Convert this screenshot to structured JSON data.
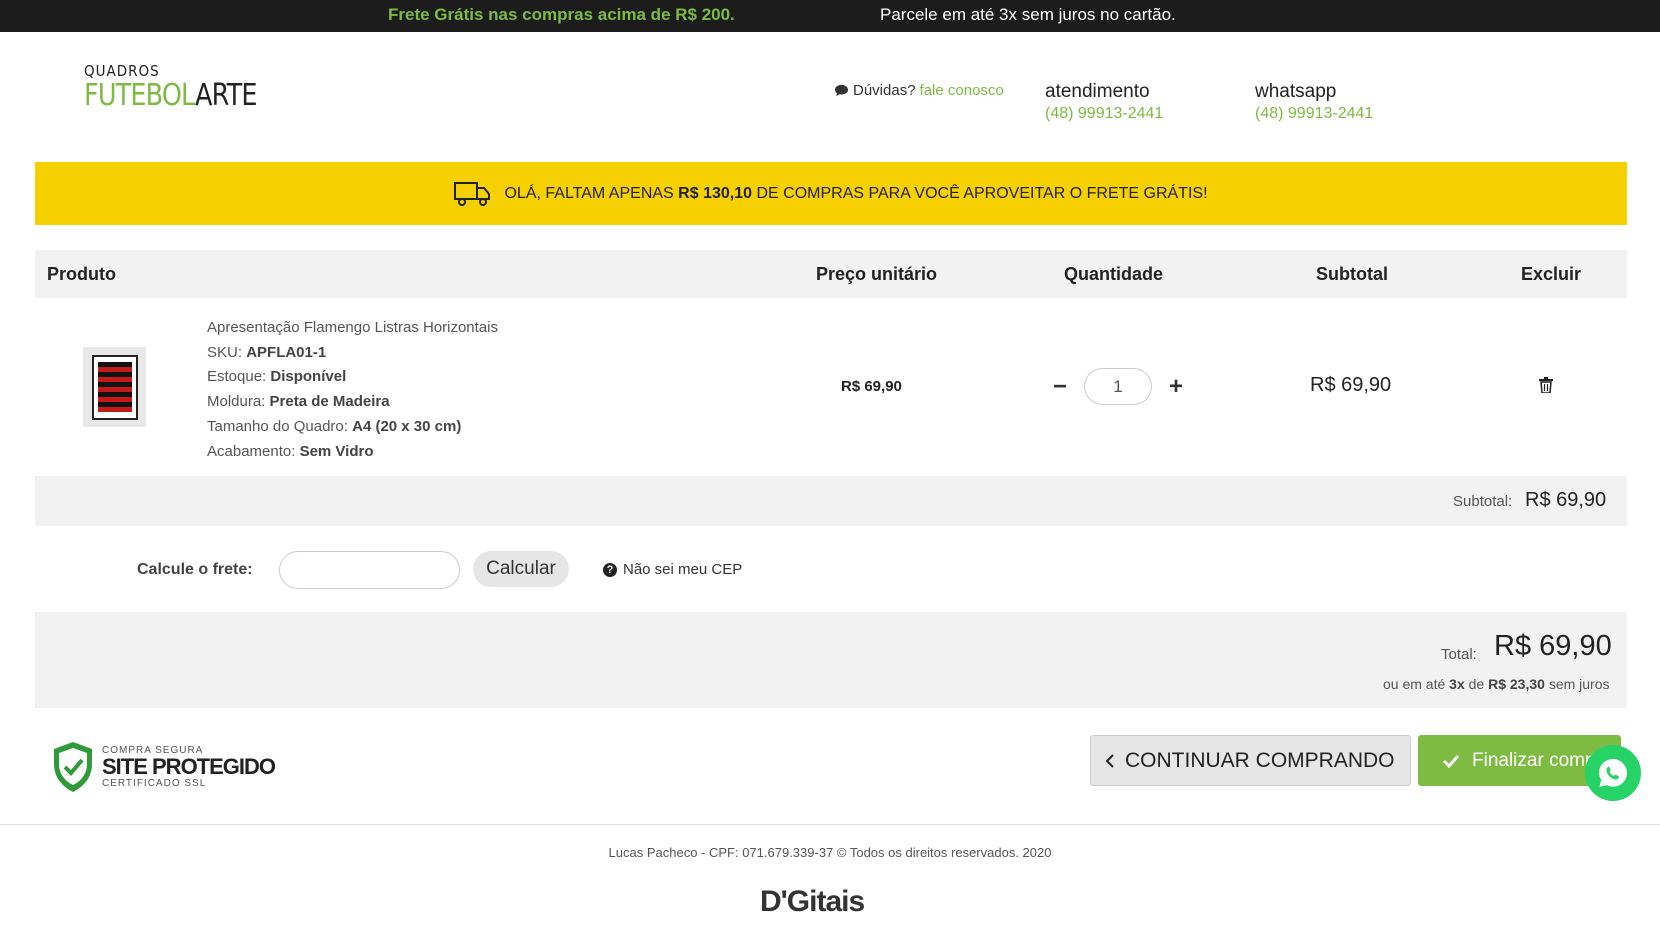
{
  "topbar": {
    "promo_free_shipping": "Frete Grátis nas compras acima de R$ 200.",
    "promo_installments": "Parcele em até 3x sem juros no cartão."
  },
  "header": {
    "logo_top": "QUADROS",
    "logo_bottom_green": "FUTEBOL",
    "logo_bottom_dark": "ARTE",
    "questions_label": "Dúvidas?",
    "contact_link": "fale conosco",
    "service_label": "atendimento",
    "service_phone": "(48) 99913-2441",
    "whatsapp_label": "whatsapp",
    "whatsapp_phone": "(48) 99913-2441"
  },
  "shipping_banner": {
    "prefix": "OLÁ, FALTAM APENAS",
    "amount": "R$ 130,10",
    "suffix": "DE COMPRAS PARA VOCÊ APROVEITAR O FRETE GRÁTIS!"
  },
  "table": {
    "headers": {
      "product": "Produto",
      "unit_price": "Preço unitário",
      "quantity": "Quantidade",
      "subtotal": "Subtotal",
      "delete": "Excluir"
    }
  },
  "cart_item": {
    "name": "Apresentação Flamengo Listras Horizontais",
    "sku_label": "SKU:",
    "sku": "APFLA01-1",
    "stock_label": "Estoque:",
    "stock": "Disponível",
    "frame_label": "Moldura:",
    "frame": "Preta de Madeira",
    "size_label": "Tamanho do Quadro:",
    "size": "A4 (20 x 30 cm)",
    "finish_label": "Acabamento:",
    "finish": "Sem Vidro",
    "unit_price": "R$ 69,90",
    "quantity": "1",
    "subtotal": "R$ 69,90",
    "minus": "−",
    "plus": "+"
  },
  "summary": {
    "subtotal_label": "Subtotal:",
    "subtotal_value": "R$ 69,90",
    "total_label": "Total:",
    "total_value": "R$ 69,90",
    "installments_prefix": "ou em até",
    "installments_count": "3x",
    "installments_of": "de",
    "installments_value": "R$ 23,30",
    "installments_suffix": "sem juros"
  },
  "shipping_calc": {
    "label": "Calcule o frete:",
    "input_value": "",
    "button": "Calcular",
    "help": "Não sei meu CEP"
  },
  "seal": {
    "line1": "COMPRA SEGURA",
    "line2": "SITE PROTEGIDO",
    "line3": "CERTIFICADO SSL"
  },
  "actions": {
    "continue": "CONTINUAR COMPRANDO",
    "finish": "Finalizar compra"
  },
  "footer": {
    "copyright": "Lucas Pacheco - CPF: 071.679.339-37 © Todos os direitos reservados. 2020",
    "brand": "D'Gitais"
  },
  "colors": {
    "accent_green": "#7dbb42",
    "banner_yellow": "#f7d000",
    "topbar_dark": "#1c1c1c",
    "whatsapp_green": "#25d366"
  }
}
